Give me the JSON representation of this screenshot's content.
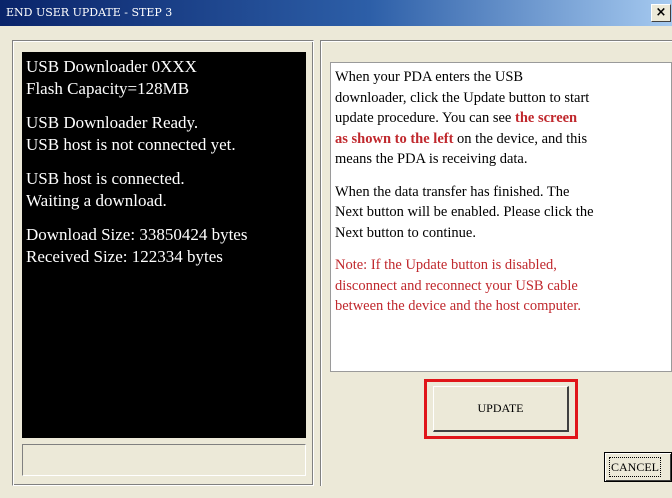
{
  "window": {
    "title": "END USER UPDATE - STEP 3",
    "close_glyph": "×"
  },
  "console": {
    "lines": [
      "USB Downloader 0XXX",
      "Flash Capacity=128MB",
      "USB Downloader Ready.",
      "USB host is not connected yet.",
      "USB host is connected.",
      "Waiting a download.",
      "Download Size: 33850424 bytes",
      "Received Size: 122334 bytes"
    ]
  },
  "instructions": {
    "p1_lines": [
      "When your PDA enters the USB",
      "downloader, click the Update button to start",
      "update procedure. You can see ",
      "the screen",
      "as shown to the left",
      " on the device, and this",
      "means the PDA is receiving data."
    ],
    "p2_lines": [
      "When the data transfer has finished. The",
      "Next button will be enabled. Please click the",
      "Next button to continue."
    ],
    "note_lines": [
      "Note: If the Update button is disabled,",
      "disconnect and reconnect your USB cable",
      "between the device and the host computer."
    ]
  },
  "buttons": {
    "update_label": "UPDATE",
    "cancel_label": "CANCEL"
  },
  "colors": {
    "highlight": "#e0151a",
    "emphasis_text": "#c0282d",
    "titlebar_start": "#0a246a"
  }
}
